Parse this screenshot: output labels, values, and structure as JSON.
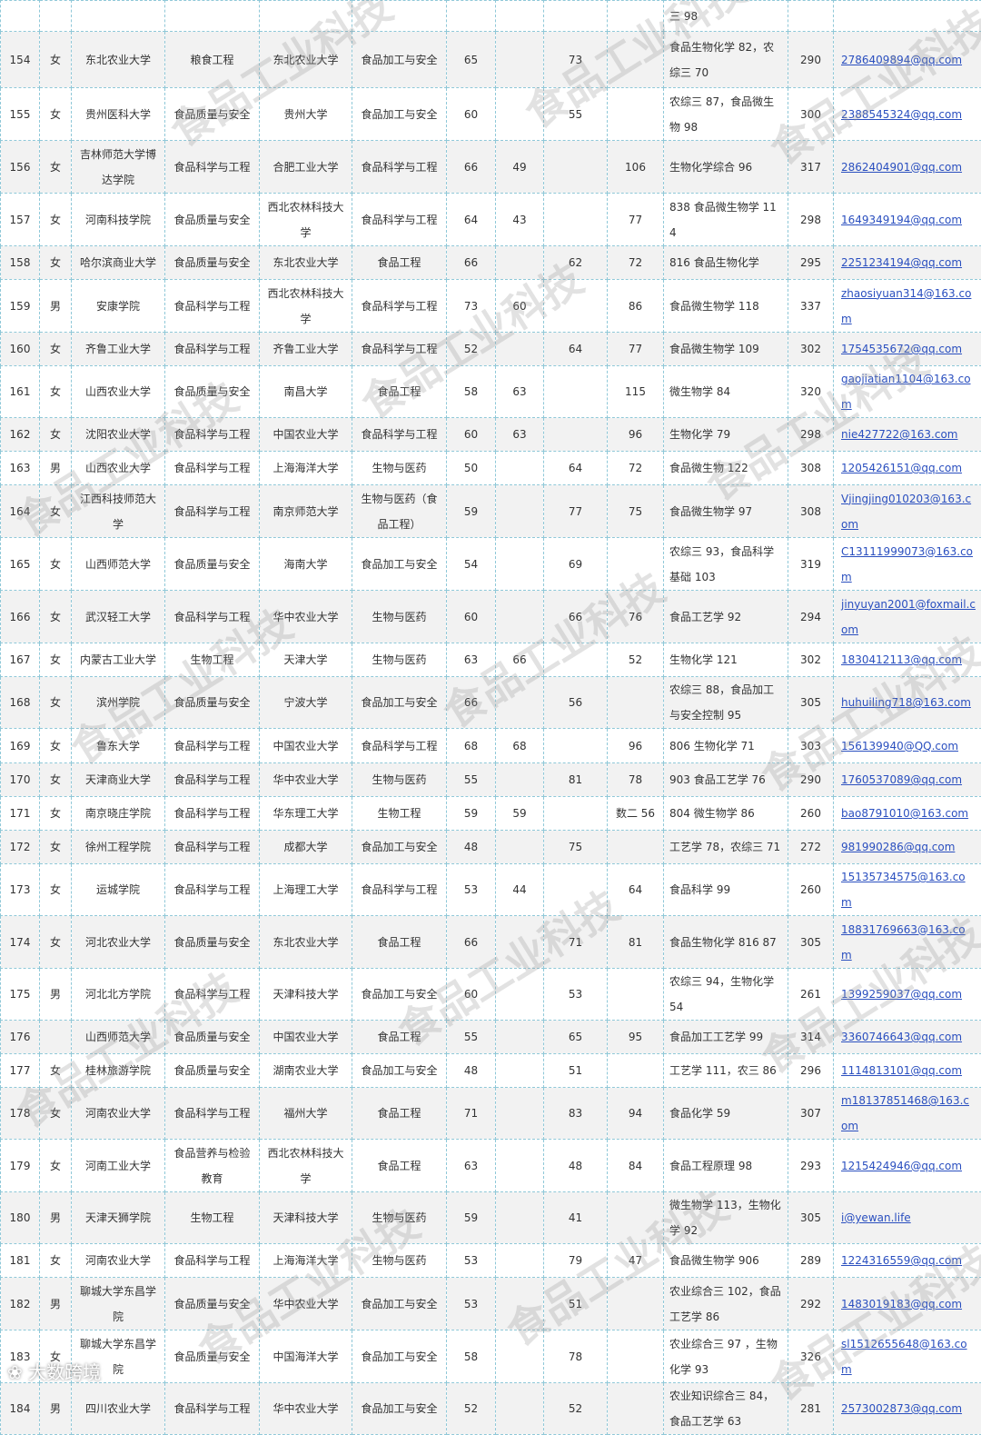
{
  "rows": [
    {
      "no": "",
      "gender": "",
      "undergrad": "",
      "ug_major": "",
      "target_univ": "",
      "target_major": "",
      "politics": "",
      "english": "",
      "russian": "",
      "math": "",
      "pro": "三 98",
      "total": "",
      "email": "",
      "h": 34
    },
    {
      "no": "154",
      "gender": "女",
      "undergrad": "东北农业大学",
      "ug_major": "粮食工程",
      "target_univ": "东北农业大学",
      "target_major": "食品加工与安全",
      "politics": "65",
      "english": "",
      "russian": "73",
      "math": "",
      "pro": "食品生物化学 82，农综三 70",
      "total": "290",
      "email": "2786409894@qq.com",
      "h": 62
    },
    {
      "no": "155",
      "gender": "女",
      "undergrad": "贵州医科大学",
      "ug_major": "食品质量与安全",
      "target_univ": "贵州大学",
      "target_major": "食品加工与安全",
      "politics": "60",
      "english": "",
      "russian": "55",
      "math": "",
      "pro": "农综三 87，食品微生物 98",
      "total": "300",
      "email": "2388545324@qq.com",
      "h": 58
    },
    {
      "no": "156",
      "gender": "女",
      "undergrad": "吉林师范大学博达学院",
      "ug_major": "食品科学与工程",
      "target_univ": "合肥工业大学",
      "target_major": "食品科学与工程",
      "politics": "66",
      "english": "49",
      "russian": "",
      "math": "106",
      "pro": "生物化学综合 96",
      "total": "317",
      "email": "2862404901@qq.com",
      "h": 58
    },
    {
      "no": "157",
      "gender": "女",
      "undergrad": "河南科技学院",
      "ug_major": "食品质量与安全",
      "target_univ": "西北农林科技大学",
      "target_major": "食品科学与工程",
      "politics": "64",
      "english": "43",
      "russian": "",
      "math": "77",
      "pro": "838 食品微生物学 114",
      "total": "298",
      "email": "1649349194@qq.com",
      "h": 58
    },
    {
      "no": "158",
      "gender": "女",
      "undergrad": "哈尔滨商业大学",
      "ug_major": "食品质量与安全",
      "target_univ": "东北农业大学",
      "target_major": "食品工程",
      "politics": "66",
      "english": "",
      "russian": "62",
      "math": "72",
      "pro": "816 食品生物化学",
      "total": "295",
      "email": "2251234194@qq.com",
      "h": 37
    },
    {
      "no": "159",
      "gender": "男",
      "undergrad": "安康学院",
      "ug_major": "食品科学与工程",
      "target_univ": "西北农林科技大学",
      "target_major": "食品科学与工程",
      "politics": "73",
      "english": "60",
      "russian": "",
      "math": "86",
      "pro": "食品微生物学 118",
      "total": "337",
      "email": "zhaosiyuan314@163.com",
      "h": 58
    },
    {
      "no": "160",
      "gender": "女",
      "undergrad": "齐鲁工业大学",
      "ug_major": "食品科学与工程",
      "target_univ": "齐鲁工业大学",
      "target_major": "食品科学与工程",
      "politics": "52",
      "english": "",
      "russian": "64",
      "math": "77",
      "pro": "食品微生物学 109",
      "total": "302",
      "email": "1754535672@qq.com",
      "h": 37
    },
    {
      "no": "161",
      "gender": "女",
      "undergrad": "山西农业大学",
      "ug_major": "食品质量与安全",
      "target_univ": "南昌大学",
      "target_major": "食品工程",
      "politics": "58",
      "english": "63",
      "russian": "",
      "math": "115",
      "pro": "微生物学 84",
      "total": "320",
      "email": "gaojiatian1104@163.com",
      "h": 37
    },
    {
      "no": "162",
      "gender": "女",
      "undergrad": "沈阳农业大学",
      "ug_major": "食品科学与工程",
      "target_univ": "中国农业大学",
      "target_major": "食品科学与工程",
      "politics": "60",
      "english": "63",
      "russian": "",
      "math": "96",
      "pro": "生物化学 79",
      "total": "298",
      "email": "nie427722@163.com",
      "h": 37
    },
    {
      "no": "163",
      "gender": "男",
      "undergrad": "山西农业大学",
      "ug_major": "食品科学与工程",
      "target_univ": "上海海洋大学",
      "target_major": "生物与医药",
      "politics": "50",
      "english": "",
      "russian": "64",
      "math": "72",
      "pro": "食品微生物 122",
      "total": "308",
      "email": "1205426151@qq.com",
      "h": 37
    },
    {
      "no": "164",
      "gender": "女",
      "undergrad": "江西科技师范大学",
      "ug_major": "食品科学与工程",
      "target_univ": "南京师范大学",
      "target_major": "生物与医药（食品工程）",
      "politics": "59",
      "english": "",
      "russian": "77",
      "math": "75",
      "pro": "食品微生物学 97",
      "total": "308",
      "email": "Vjingjing010203@163.com",
      "h": 58
    },
    {
      "no": "165",
      "gender": "女",
      "undergrad": "山西师范大学",
      "ug_major": "食品质量与安全",
      "target_univ": "海南大学",
      "target_major": "食品加工与安全",
      "politics": "54",
      "english": "",
      "russian": "69",
      "math": "",
      "pro": "农综三 93，食品科学基础 103",
      "total": "319",
      "email": "C13111999073@163.com",
      "h": 58
    },
    {
      "no": "166",
      "gender": "女",
      "undergrad": "武汉轻工大学",
      "ug_major": "食品科学与工程",
      "target_univ": "华中农业大学",
      "target_major": "生物与医药",
      "politics": "60",
      "english": "",
      "russian": "66",
      "math": "76",
      "pro": "食品工艺学 92",
      "total": "294",
      "email": "jinyuyan2001@foxmail.com",
      "h": 58
    },
    {
      "no": "167",
      "gender": "女",
      "undergrad": "内蒙古工业大学",
      "ug_major": "生物工程",
      "target_univ": "天津大学",
      "target_major": "生物与医药",
      "politics": "63",
      "english": "66",
      "russian": "",
      "math": "52",
      "pro": "生物化学 121",
      "total": "302",
      "email": "1830412113@qq.com",
      "h": 37
    },
    {
      "no": "168",
      "gender": "女",
      "undergrad": "滨州学院",
      "ug_major": "食品质量与安全",
      "target_univ": "宁波大学",
      "target_major": "食品加工与安全",
      "politics": "66",
      "english": "",
      "russian": "56",
      "math": "",
      "pro": "农综三 88，食品加工与安全控制 95",
      "total": "305",
      "email": "huhuiling718@163.com",
      "h": 57
    },
    {
      "no": "169",
      "gender": "女",
      "undergrad": "鲁东大学",
      "ug_major": "食品科学与工程",
      "target_univ": "中国农业大学",
      "target_major": "食品科学与工程",
      "politics": "68",
      "english": "68",
      "russian": "",
      "math": "96",
      "pro": "806 生物化学 71",
      "total": "303",
      "email": "156139940@QQ.com",
      "h": 38
    },
    {
      "no": "170",
      "gender": "女",
      "undergrad": "天津商业大学",
      "ug_major": "食品科学与工程",
      "target_univ": "华中农业大学",
      "target_major": "生物与医药",
      "politics": "55",
      "english": "",
      "russian": "81",
      "math": "78",
      "pro": "903 食品工艺学 76",
      "total": "290",
      "email": "1760537089@qq.com",
      "h": 37
    },
    {
      "no": "171",
      "gender": "女",
      "undergrad": "南京晓庄学院",
      "ug_major": "食品科学与工程",
      "target_univ": "华东理工大学",
      "target_major": "生物工程",
      "politics": "59",
      "english": "59",
      "russian": "",
      "math": "数二 56",
      "pro": "804 微生物学 86",
      "total": "260",
      "email": "bao8791010@163.com",
      "h": 37
    },
    {
      "no": "172",
      "gender": "女",
      "undergrad": "徐州工程学院",
      "ug_major": "食品科学与工程",
      "target_univ": "成都大学",
      "target_major": "食品加工与安全",
      "politics": "48",
      "english": "",
      "russian": "75",
      "math": "",
      "pro": "工艺学 78，农综三 71",
      "total": "272",
      "email": "981990286@qq.com",
      "h": 37
    },
    {
      "no": "173",
      "gender": "女",
      "undergrad": "运城学院",
      "ug_major": "食品科学与工程",
      "target_univ": "上海理工大学",
      "target_major": "食品科学与工程",
      "politics": "53",
      "english": "44",
      "russian": "",
      "math": "64",
      "pro": "食品科学 99",
      "total": "260",
      "email": "15135734575@163.com",
      "h": 37
    },
    {
      "no": "174",
      "gender": "女",
      "undergrad": "河北农业大学",
      "ug_major": "食品质量与安全",
      "target_univ": "东北农业大学",
      "target_major": "食品工程",
      "politics": "66",
      "english": "",
      "russian": "71",
      "math": "81",
      "pro": "食品生物化学 816 87",
      "total": "305",
      "email": "18831769663@163.com",
      "h": 58
    },
    {
      "no": "175",
      "gender": "男",
      "undergrad": "河北北方学院",
      "ug_major": "食品科学与工程",
      "target_univ": "天津科技大学",
      "target_major": "食品加工与安全",
      "politics": "60",
      "english": "",
      "russian": "53",
      "math": "",
      "pro": "农综三 94，生物化学 54",
      "total": "261",
      "email": "1399259037@qq.com",
      "h": 57
    },
    {
      "no": "176",
      "gender": "",
      "undergrad": "山西师范大学",
      "ug_major": "食品质量与安全",
      "target_univ": "中国农业大学",
      "target_major": "食品工程",
      "politics": "55",
      "english": "",
      "russian": "65",
      "math": "95",
      "pro": "食品加工工艺学 99",
      "total": "314",
      "email": "3360746643@qq.com",
      "h": 37
    },
    {
      "no": "177",
      "gender": "女",
      "undergrad": "桂林旅游学院",
      "ug_major": "食品质量与安全",
      "target_univ": "湖南农业大学",
      "target_major": "食品加工与安全",
      "politics": "48",
      "english": "",
      "russian": "51",
      "math": "",
      "pro": "工艺学 111，农三 86",
      "total": "296",
      "email": "1114813101@qq.com",
      "h": 37
    },
    {
      "no": "178",
      "gender": "女",
      "undergrad": "河南农业大学",
      "ug_major": "食品科学与工程",
      "target_univ": "福州大学",
      "target_major": "食品工程",
      "politics": "71",
      "english": "",
      "russian": "83",
      "math": "94",
      "pro": "食品化学 59",
      "total": "307",
      "email": "m18137851468@163.com",
      "h": 37
    },
    {
      "no": "179",
      "gender": "女",
      "undergrad": "河南工业大学",
      "ug_major": "食品营养与检验教育",
      "target_univ": "西北农林科技大学",
      "target_major": "食品工程",
      "politics": "63",
      "english": "",
      "russian": "48",
      "math": "84",
      "pro": "食品工程原理 98",
      "total": "293",
      "email": "1215424946@qq.com",
      "h": 58
    },
    {
      "no": "180",
      "gender": "男",
      "undergrad": "天津天狮学院",
      "ug_major": "生物工程",
      "target_univ": "天津科技大学",
      "target_major": "生物与医药",
      "politics": "59",
      "english": "",
      "russian": "41",
      "math": "",
      "pro": "微生物学 113，生物化学 92",
      "total": "305",
      "email": "i@yewan.life",
      "h": 57
    },
    {
      "no": "181",
      "gender": "女",
      "undergrad": "河南农业大学",
      "ug_major": "食品科学与工程",
      "target_univ": "上海海洋大学",
      "target_major": "生物与医药",
      "politics": "53",
      "english": "",
      "russian": "79",
      "math": "47",
      "pro": "食品微生物学 906",
      "total": "289",
      "email": "1224316559@qq.com",
      "h": 37
    },
    {
      "no": "182",
      "gender": "男",
      "undergrad": "聊城大学东昌学院",
      "ug_major": "食品质量与安全",
      "target_univ": "华中农业大学",
      "target_major": "食品加工与安全",
      "politics": "53",
      "english": "",
      "russian": "51",
      "math": "",
      "pro": "农业综合三 102，食品工艺学 86",
      "total": "292",
      "email": "1483019183@qq.com",
      "h": 58
    },
    {
      "no": "183",
      "gender": "女",
      "undergrad": "聊城大学东昌学院",
      "ug_major": "食品质量与安全",
      "target_univ": "中国海洋大学",
      "target_major": "食品加工与安全",
      "politics": "58",
      "english": "",
      "russian": "78",
      "math": "",
      "pro": "农业综合三 97 ，生物化学 93",
      "total": "326",
      "email": "sl1512655648@163.com",
      "h": 58
    },
    {
      "no": "184",
      "gender": "男",
      "undergrad": "四川农业大学",
      "ug_major": "食品科学与工程",
      "target_univ": "华中农业大学",
      "target_major": "食品加工与安全",
      "politics": "52",
      "english": "",
      "russian": "52",
      "math": "",
      "pro": "农业知识综合三 84，食品工艺学 63",
      "total": "281",
      "email": "2573002873@qq.com",
      "h": 56
    }
  ],
  "watermark": "食品工业科技",
  "footer": "大数跨境"
}
